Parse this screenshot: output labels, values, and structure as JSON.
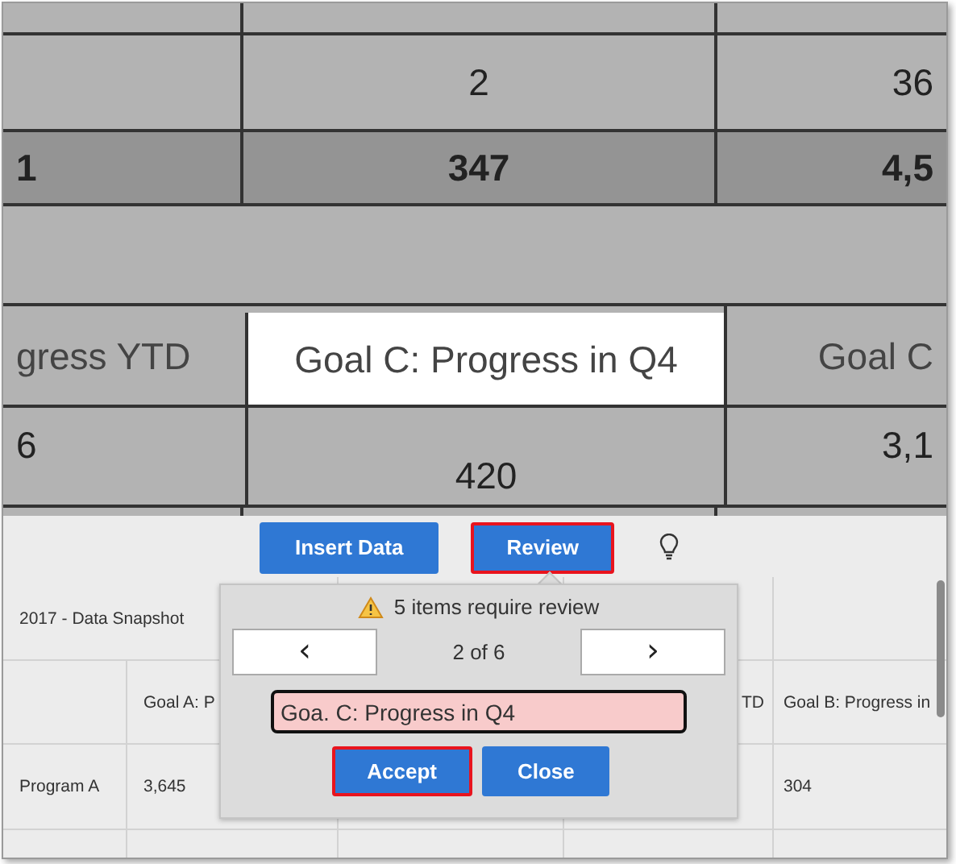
{
  "document_image": {
    "rows": [
      {
        "kind": "top",
        "cells": [
          {},
          {},
          {}
        ]
      },
      {
        "kind": "plain",
        "cells": [
          {},
          {
            "text": "2"
          },
          {
            "text": "36"
          }
        ]
      },
      {
        "kind": "total",
        "cells": [
          {
            "text": "1"
          },
          {
            "text": "347"
          },
          {
            "text": "4,5"
          }
        ]
      },
      {
        "kind": "gap",
        "cells": []
      },
      {
        "kind": "header",
        "cells": [
          {
            "text": "gress YTD",
            "highlighted": false
          },
          {
            "text": "Goal C: Progress in Q4",
            "highlighted": true
          },
          {
            "text": "Goal C",
            "highlighted": false
          }
        ]
      },
      {
        "kind": "value",
        "cells": [
          {
            "text": "6"
          },
          {
            "text": "420"
          },
          {
            "text": "3,1"
          }
        ]
      },
      {
        "kind": "top",
        "cells": [
          {},
          {},
          {}
        ]
      }
    ]
  },
  "toolbar": {
    "buttons": [
      {
        "label": "Insert Data",
        "selected": false
      },
      {
        "label": "Review",
        "selected": true
      }
    ]
  },
  "sheet": {
    "title": "2017 - Data Snapshot",
    "rows": [
      {
        "cells": [
          {},
          {
            "text": "Goal A: P"
          },
          {},
          {
            "text": "TD",
            "kind": "covered"
          },
          {
            "text": "Goal B: Progress in"
          }
        ]
      },
      {
        "cells": [
          {
            "text": "Program A"
          },
          {
            "text": "3,645"
          },
          {},
          {},
          {
            "text": "304"
          }
        ]
      },
      {
        "cells": [
          {},
          {},
          {},
          {},
          {}
        ]
      }
    ]
  },
  "review_popup": {
    "message": "5 items require review",
    "prev": "‹",
    "next": "›",
    "position": "2 of 6",
    "value": "Goa. C: Progress in Q4",
    "buttons": [
      {
        "label": "Accept",
        "selected": true
      },
      {
        "label": "Close",
        "selected": false
      }
    ]
  }
}
